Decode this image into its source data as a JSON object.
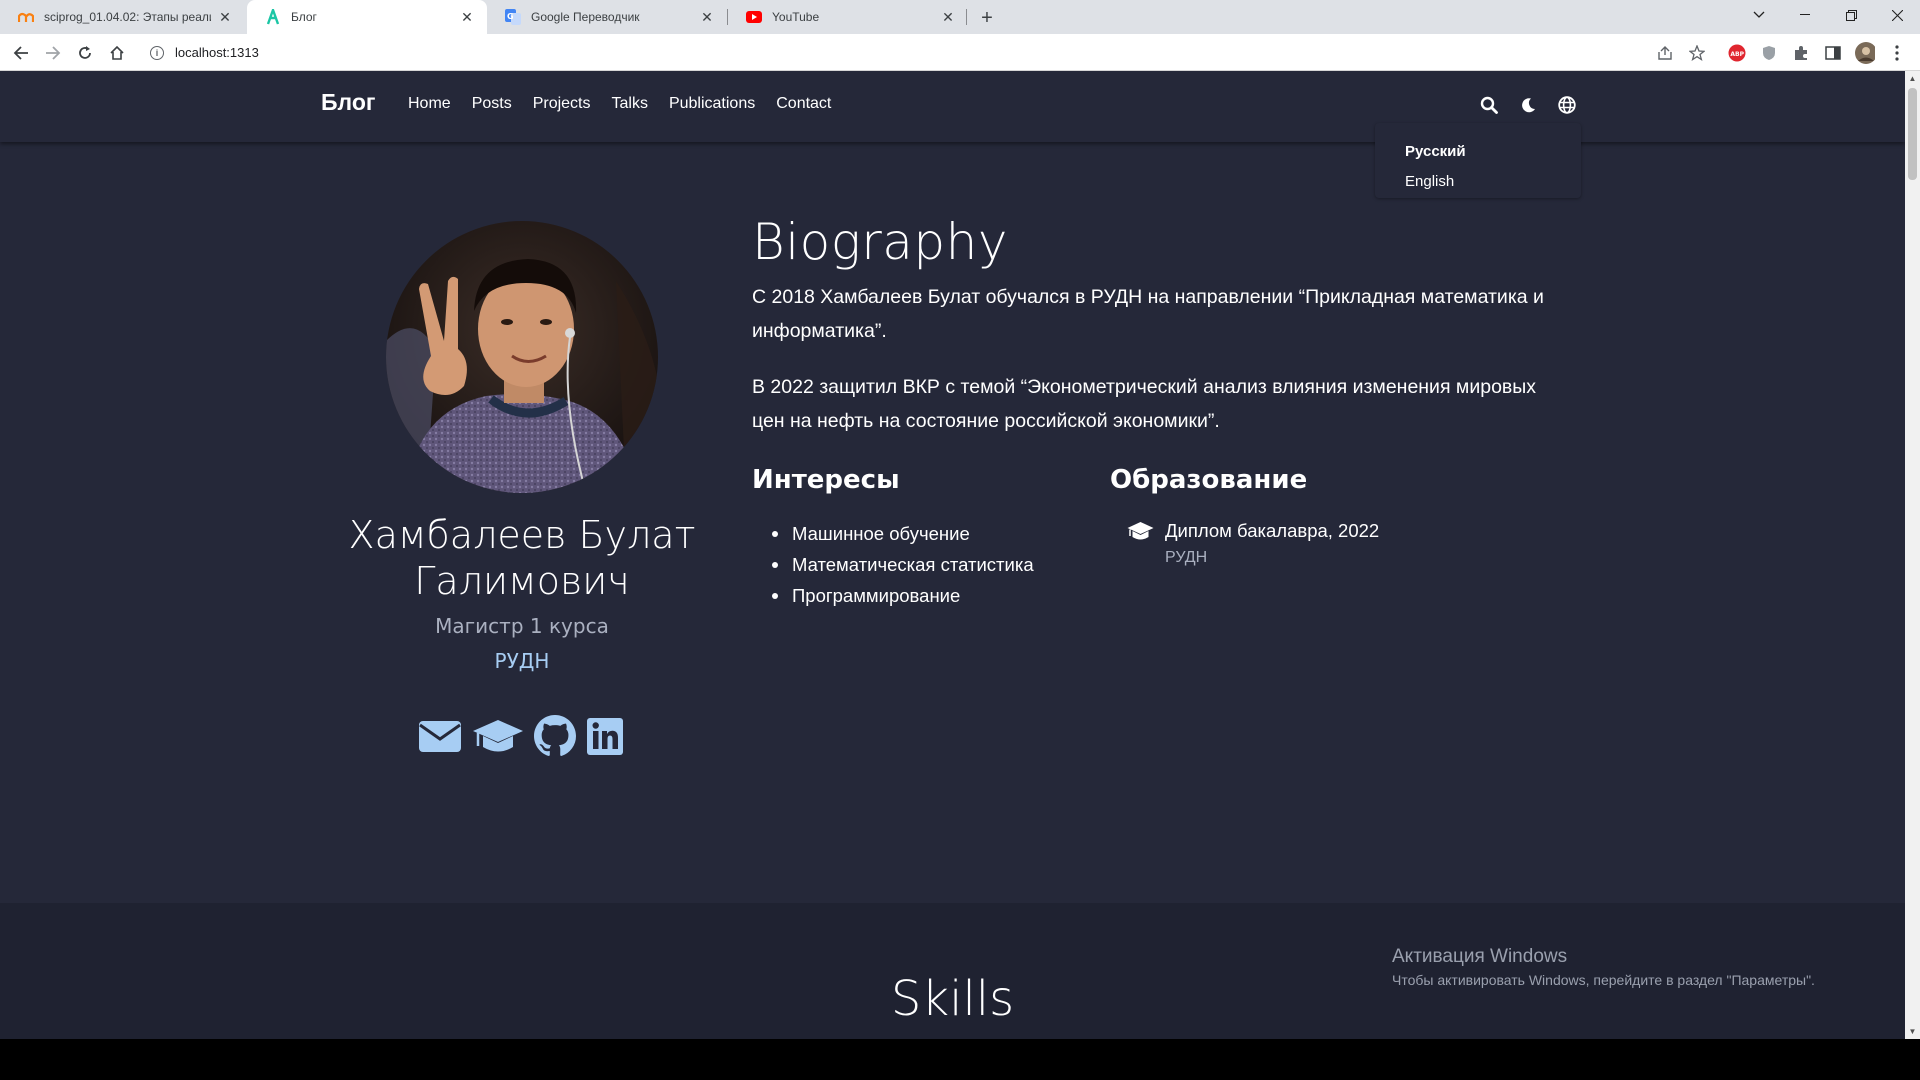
{
  "browser": {
    "tabs": [
      {
        "title": "sciprog_01.04.02: Этапы реализа",
        "icon": "moodle-icon"
      },
      {
        "title": "Блог",
        "icon": "hugo-icon"
      },
      {
        "title": "Google Переводчик",
        "icon": "google-translate-icon"
      },
      {
        "title": "YouTube",
        "icon": "youtube-icon"
      }
    ],
    "address": "localhost:1313"
  },
  "site": {
    "brand": "Блог",
    "menu": [
      "Home",
      "Posts",
      "Projects",
      "Talks",
      "Publications",
      "Contact"
    ],
    "languages": [
      "Русский",
      "English"
    ]
  },
  "profile": {
    "name_line1": "Хамбалеев Булат",
    "name_line2": "Галимович",
    "role": "Магистр 1 курса",
    "org": "РУДН",
    "socials": [
      "envelope-icon",
      "graduation-cap-icon",
      "github-icon",
      "linkedin-icon"
    ]
  },
  "biography": {
    "title": "Biography",
    "p1": "С 2018 Хамбалеев Булат обучался в РУДН на направлении “Прикладная математика и информатика”.",
    "p2": "В 2022 защитил ВКР с темой “Эконометрический анализ влияния изменения мировых цен на нефть на состояние российской экономики”.",
    "interests_title": "Интересы",
    "interests": [
      "Машинное обучение",
      "Математическая статистика",
      "Программирование"
    ],
    "education_title": "Образование",
    "education": {
      "degree": "Диплом бакалавра, 2022",
      "institution": "РУДН"
    }
  },
  "next_section": {
    "title": "Skills"
  },
  "windows_watermark": {
    "line1": "Активация Windows",
    "line2": "Чтобы активировать Windows, перейдите в раздел \"Параметры\"."
  }
}
